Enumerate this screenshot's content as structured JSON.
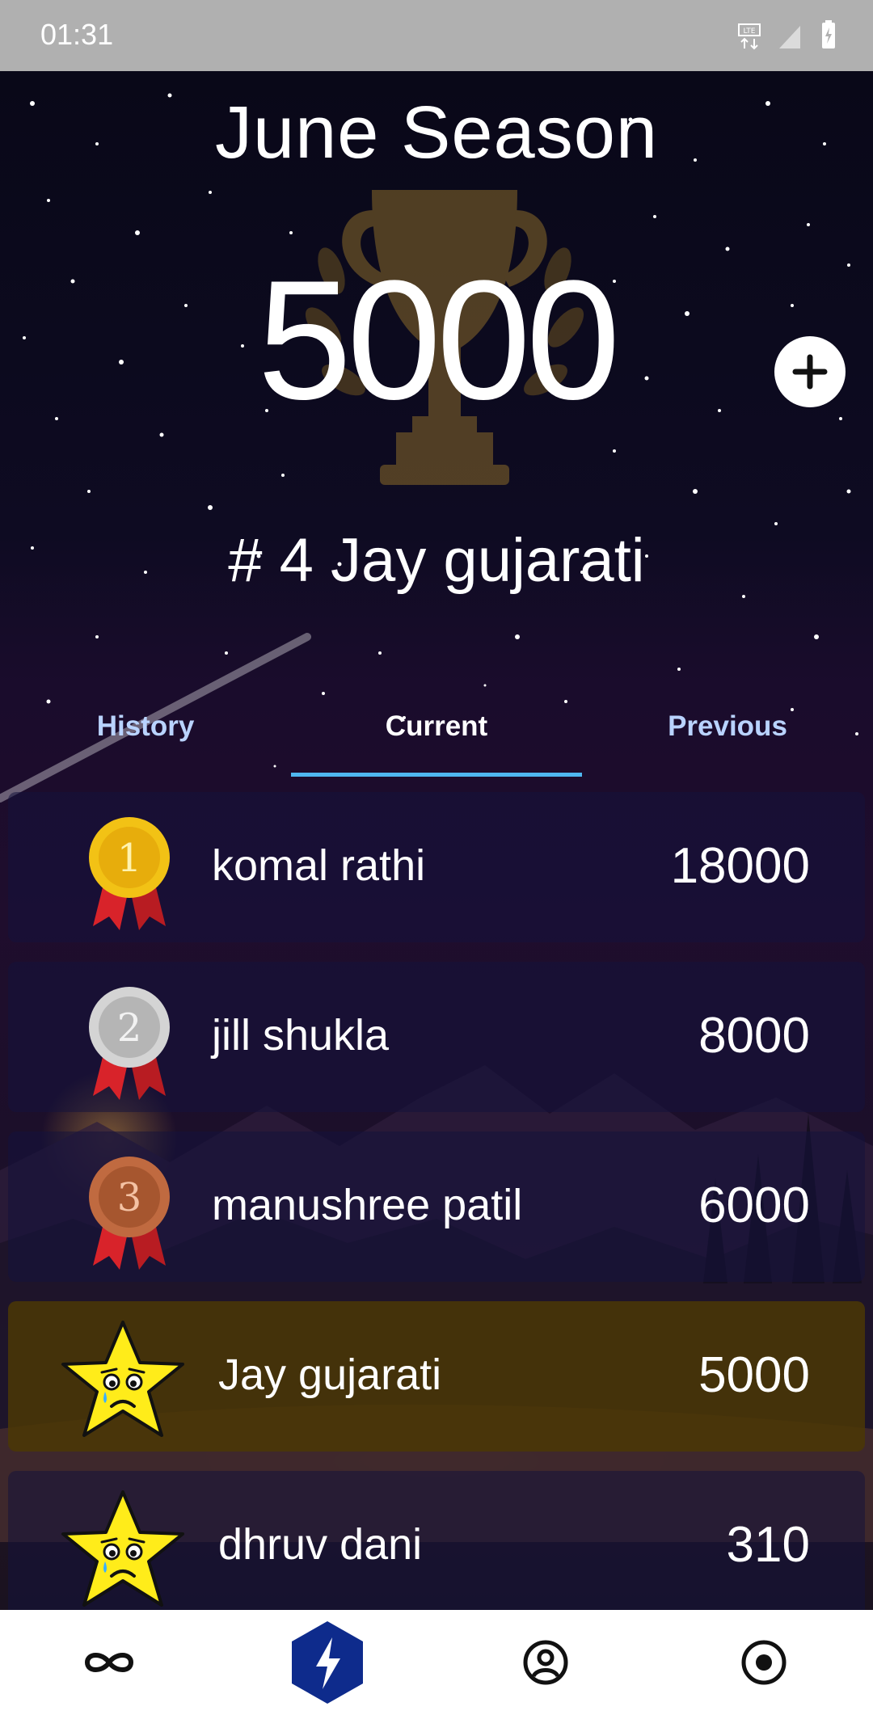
{
  "status_bar": {
    "time": "01:31"
  },
  "header": {
    "season_title": "June Season",
    "score": "5000",
    "rank_line": "# 4  Jay gujarati"
  },
  "tabs": [
    {
      "label": "History"
    },
    {
      "label": "Current"
    },
    {
      "label": "Previous"
    }
  ],
  "leaderboard": [
    {
      "badge_number": "1",
      "name": "komal rathi",
      "points": "18000"
    },
    {
      "badge_number": "2",
      "name": "jill shukla",
      "points": "8000"
    },
    {
      "badge_number": "3",
      "name": "manushree patil",
      "points": "6000"
    },
    {
      "name": "Jay gujarati",
      "points": "5000"
    },
    {
      "name": "dhruv dani",
      "points": "310"
    }
  ],
  "bottom_nav": [
    "infinity-icon",
    "bolt-icon",
    "profile-icon",
    "target-icon"
  ],
  "colors": {
    "tab_indicator": "#4fb7f0",
    "me_row": "#4b3705",
    "nav_active": "#0e2b8c"
  }
}
